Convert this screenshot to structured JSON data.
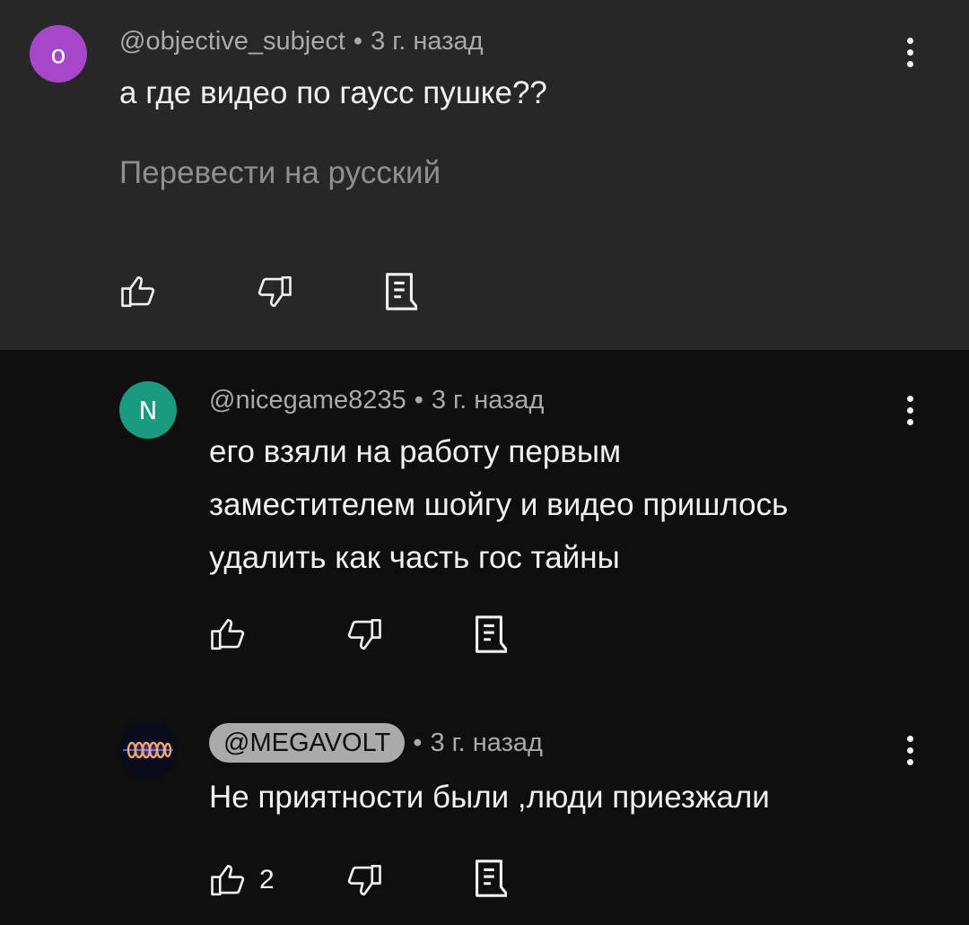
{
  "colors": {
    "highlight_bg": "#272727",
    "page_bg": "#0f0f0f",
    "avatar_o": "#a646c8",
    "avatar_n": "#1a9a7f"
  },
  "comments": [
    {
      "avatar_letter": "o",
      "author": "@objective_subject",
      "separator": "•",
      "time": "3 г. назад",
      "text": "а где видео по гаусс пушке??",
      "translate_label": "Перевести на русский",
      "likes": ""
    },
    {
      "avatar_letter": "N",
      "author": "@nicegame8235",
      "separator": "•",
      "time": "3 г. назад",
      "text_lines": [
        "его взяли на работу первым",
        "заместителем шойгу и видео пришлось",
        "удалить как часть гос тайны"
      ],
      "likes": ""
    },
    {
      "avatar_letter": "",
      "author": "@MEGAVOLT",
      "separator": "•",
      "time": "3 г. назад",
      "text": "Не приятности были ,люди приезжали",
      "likes": "2"
    }
  ],
  "icons": [
    "like-icon",
    "dislike-icon",
    "reply-icon",
    "more-vert-icon"
  ]
}
